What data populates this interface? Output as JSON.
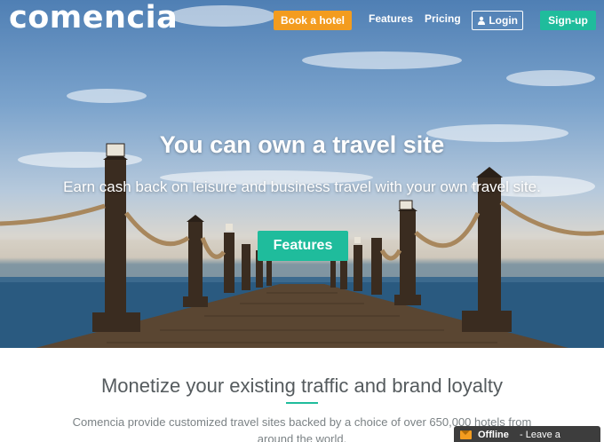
{
  "nav": {
    "logo": "comencia",
    "book_label": "Book a hotel",
    "features_label": "Features",
    "pricing_label": "Pricing",
    "login_label": "Login",
    "signup_label": "Sign-up"
  },
  "hero": {
    "title": "You can own a travel site",
    "subtitle": "Earn cash back on leisure and business travel with your own travel site.",
    "cta_label": "Features"
  },
  "section": {
    "title": "Monetize your existing traffic and brand loyalty",
    "description": "Comencia provide customized travel sites backed by a choice of over 650,000 hotels from around the world."
  },
  "chat": {
    "status": "Offline",
    "separator_text": "- Leave a Message"
  },
  "colors": {
    "accent": "#1fbc9c",
    "book_button": "#f39c1f",
    "chat_bar": "#3d3d3d"
  },
  "icons": {
    "login": "user-icon",
    "chat": "envelope-icon"
  }
}
